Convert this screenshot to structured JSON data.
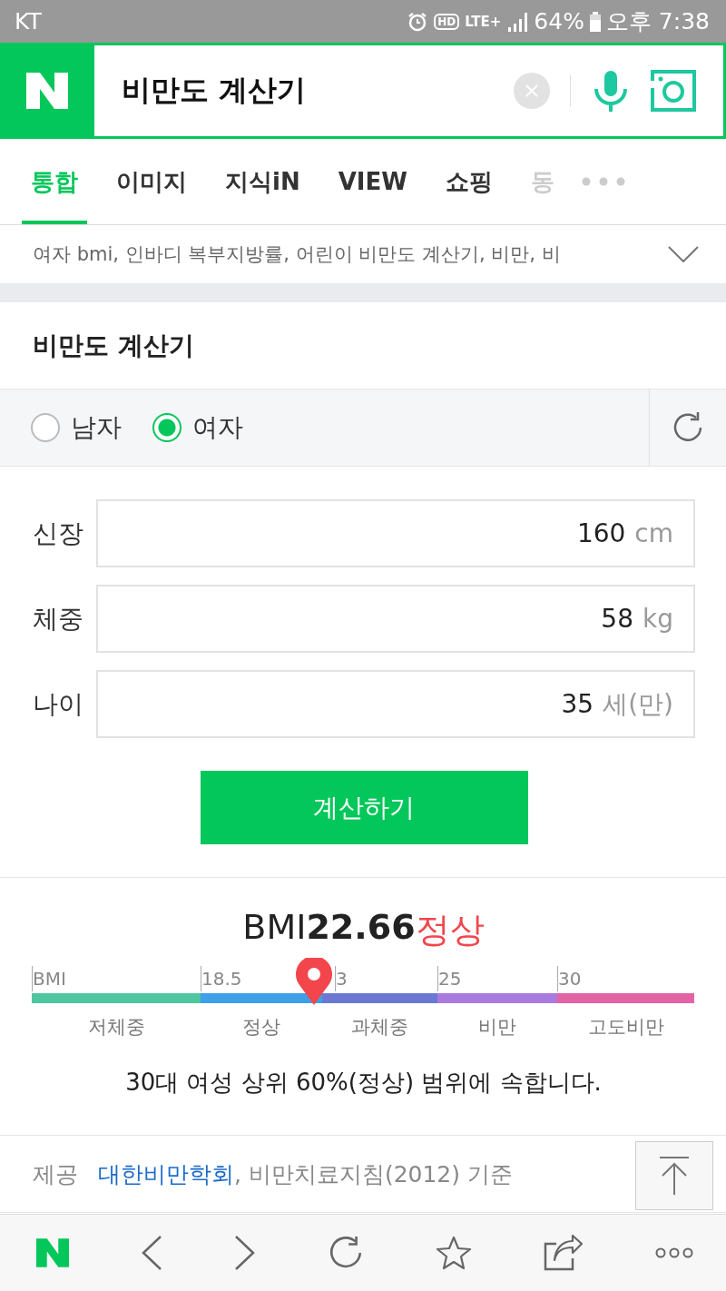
{
  "status_bar": {
    "carrier": "KT",
    "hd": "HD",
    "network": "LTE+",
    "battery": "64%",
    "time": "오후 7:38"
  },
  "search": {
    "value": "비만도 계산기"
  },
  "tabs": [
    {
      "label": "통합",
      "selected": true,
      "faded": false
    },
    {
      "label": "이미지",
      "selected": false,
      "faded": false
    },
    {
      "label": "지식iN",
      "selected": false,
      "faded": false
    },
    {
      "label": "VIEW",
      "selected": false,
      "faded": false
    },
    {
      "label": "쇼핑",
      "selected": false,
      "faded": false
    },
    {
      "label": "동",
      "selected": false,
      "faded": true
    }
  ],
  "related_keywords": "여자 bmi, 인바디 복부지방률, 어린이 비만도 계산기, 비만, 비",
  "calculator": {
    "title": "비만도 계산기",
    "gender": [
      {
        "label": "남자",
        "selected": false
      },
      {
        "label": "여자",
        "selected": true
      }
    ],
    "fields": [
      {
        "label": "신장",
        "value": "160",
        "unit": "cm"
      },
      {
        "label": "체중",
        "value": "58",
        "unit": "kg"
      },
      {
        "label": "나이",
        "value": "35",
        "unit": "세(만)"
      }
    ],
    "submit": "계산하기"
  },
  "result": {
    "prefix": "BMI",
    "value": "22.66",
    "status": "정상",
    "scale": {
      "level": 0.425,
      "ticks": [
        "BMI",
        "18.5",
        "3",
        "25",
        "30"
      ],
      "segments": [
        {
          "label": "저체중",
          "color": "#4fc6a0"
        },
        {
          "label": "정상",
          "color": "#3da0e8"
        },
        {
          "label": "과체중",
          "color": "#6a78d4"
        },
        {
          "label": "비만",
          "color": "#a97ae0"
        },
        {
          "label": "고도비만",
          "color": "#e264a6"
        }
      ]
    },
    "summary": "30대 여성 상위 60%(정상) 범위에 속합니다."
  },
  "source": {
    "label": "제공",
    "link": "대한비만학회",
    "text": ", 비만치료지침(2012) 기준"
  }
}
